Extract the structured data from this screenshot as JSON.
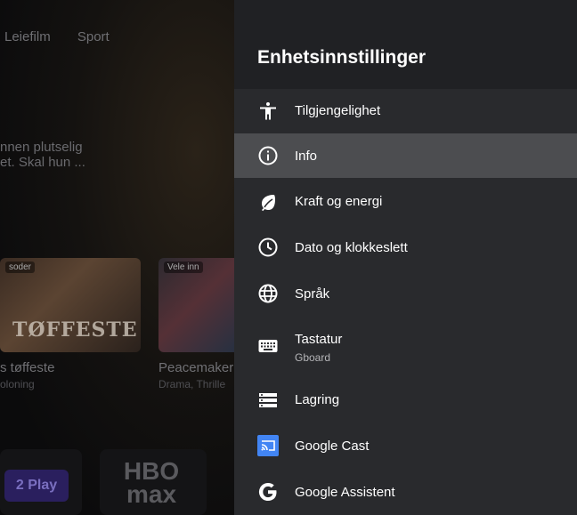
{
  "background": {
    "nav": [
      "Leiefilm",
      "Sport"
    ],
    "description": [
      "nnen plutselig",
      "et. Skal hun ..."
    ],
    "cards": [
      {
        "badge": "soder",
        "logo": "TØFFESTE",
        "title": "s tøffeste",
        "sub": "oloning"
      },
      {
        "badge": "Vele inn",
        "logo": "",
        "title": "Peacemaker",
        "sub": "Drama, Thrille"
      }
    ],
    "apps": [
      "2 Play",
      "HBO max"
    ]
  },
  "panel": {
    "title": "Enhetsinnstillinger",
    "items": [
      {
        "label": "Tilgjengelighet",
        "icon": "accessibility-icon"
      },
      {
        "label": "Info",
        "icon": "info-icon",
        "focused": true
      },
      {
        "label": "Kraft og energi",
        "icon": "leaf-icon"
      },
      {
        "label": "Dato og klokkeslett",
        "icon": "clock-icon"
      },
      {
        "label": "Språk",
        "icon": "globe-icon"
      },
      {
        "label": "Tastatur",
        "sub": "Gboard",
        "icon": "keyboard-icon"
      },
      {
        "label": "Lagring",
        "icon": "storage-icon"
      },
      {
        "label": "Google Cast",
        "icon": "cast-icon"
      },
      {
        "label": "Google Assistent",
        "icon": "google-icon"
      }
    ]
  },
  "colors": {
    "panel_bg": "#292a2d",
    "header_bg": "#202124",
    "focus_bg": "#4c4d50",
    "cast_blue": "#4285f4"
  }
}
